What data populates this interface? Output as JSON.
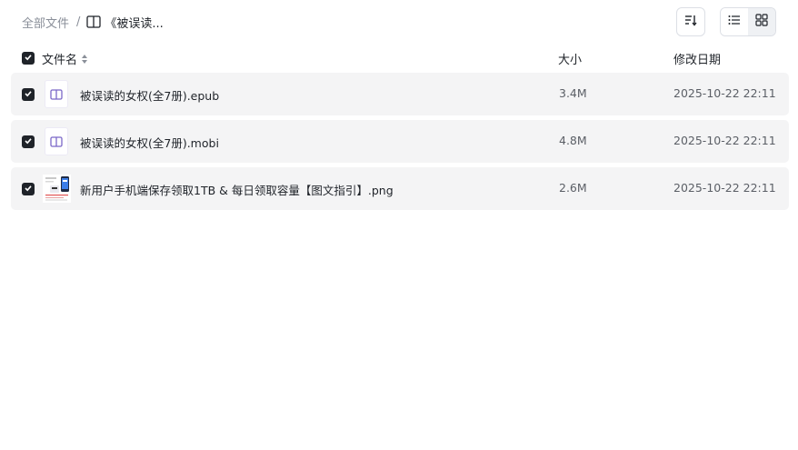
{
  "breadcrumb": {
    "root": "全部文件",
    "separator": "/",
    "current": "《被误读..."
  },
  "toolbar": {
    "sort_icon": "sort-icon",
    "list_view_icon": "list-view-icon",
    "grid_view_icon": "grid-view-icon"
  },
  "columns": {
    "name": "文件名",
    "size": "大小",
    "modified": "修改日期"
  },
  "files": [
    {
      "name": "被误读的女权(全7册).epub",
      "size": "3.4M",
      "modified": "2025-10-22 22:11",
      "icon": "ebook-icon",
      "checked": true
    },
    {
      "name": "被误读的女权(全7册).mobi",
      "size": "4.8M",
      "modified": "2025-10-22 22:11",
      "icon": "ebook-icon",
      "checked": true
    },
    {
      "name": "新用户手机端保存领取1TB & 每日领取容量【图文指引】.png",
      "size": "2.6M",
      "modified": "2025-10-22 22:11",
      "icon": "image-thumbnail",
      "checked": true
    }
  ],
  "colors": {
    "row_bg": "#f4f4f5",
    "ebook_icon": "#7b68c8",
    "checkbox": "#1f2329"
  }
}
